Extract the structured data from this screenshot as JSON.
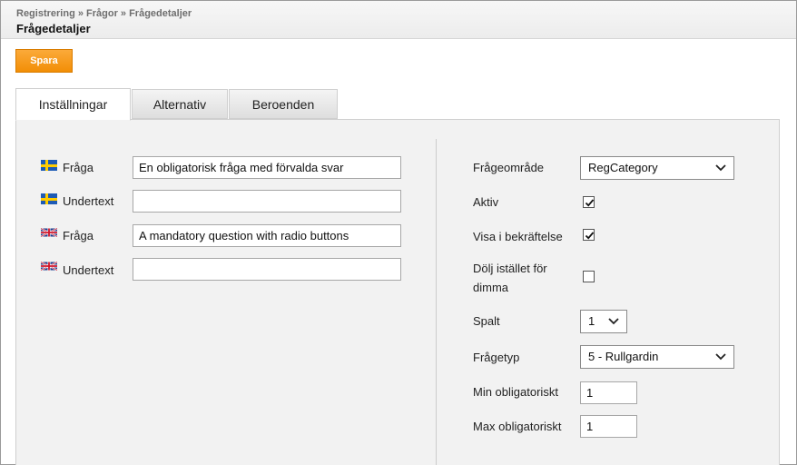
{
  "breadcrumb": "Registrering » Frågor » Frågedetaljer",
  "title": "Frågedetaljer",
  "save_label": "Spara",
  "tabs": [
    "Inställningar",
    "Alternativ",
    "Beroenden"
  ],
  "active_tab": "Inställningar",
  "left": {
    "rows": [
      {
        "flag": "sweden-flag-icon",
        "label": "Fråga",
        "value": "En obligatorisk fråga med förvalda svar"
      },
      {
        "flag": "sweden-flag-icon",
        "label": "Undertext",
        "value": ""
      },
      {
        "flag": "uk-flag-icon",
        "label": "Fråga",
        "value": "A mandatory question with radio buttons"
      },
      {
        "flag": "uk-flag-icon",
        "label": "Undertext",
        "value": ""
      }
    ]
  },
  "right": {
    "category_label": "Frågeområde",
    "category_value": "RegCategory",
    "active_label": "Aktiv",
    "active_checked": true,
    "show_label": "Visa i bekräftelse",
    "show_checked": true,
    "hide_label_line1": "Dölj istället för",
    "hide_label_line2": "dimma",
    "hide_checked": false,
    "column_label": "Spalt",
    "column_value": "1",
    "type_label": "Frågetyp",
    "type_value": "5 - Rullgardin",
    "min_label": "Min obligatoriskt",
    "min_value": "1",
    "max_label": "Max obligatoriskt",
    "max_value": "1"
  },
  "colors": {
    "accent": "#f7941d",
    "panel": "#f2f2f2",
    "flag_se_blue": "#1e5bb5",
    "flag_se_yellow": "#ffcc00",
    "flag_uk_blue": "#1f3f8f",
    "flag_uk_red": "#cf142b"
  }
}
